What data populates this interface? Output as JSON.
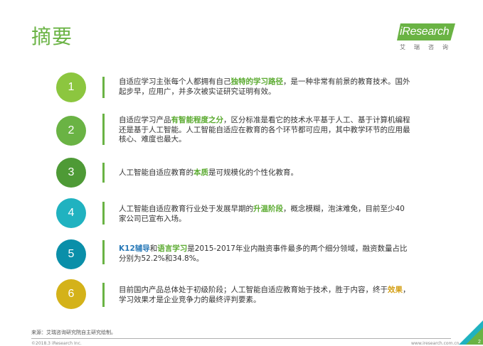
{
  "page": {
    "title": "摘要"
  },
  "logo": {
    "text": "iResearch",
    "sub": "艾瑞咨询"
  },
  "colors": {
    "accent": "#6ab344",
    "circle_1": "#8cc63f",
    "circle_2": "#6ab344",
    "circle_3": "#4e9a36",
    "circle_4": "#20b2c0",
    "circle_5": "#0a8fa9",
    "circle_6": "#d4b219"
  },
  "items": [
    {
      "num": "1",
      "parts": [
        "自适应学习主张每个人都拥有自己",
        "独特的学习路径",
        "，是一种非常有前景的教育技术。国外起步早，应用广，并多次被实证研究证明有效。"
      ]
    },
    {
      "num": "2",
      "parts": [
        "自适应学习产品",
        "有智能程度之分",
        "，区分标准是看它的技术水平基于人工、基于计算机编程还是基于人工智能。人工智能自适应在教育的各个环节都可应用，其中教学环节的应用最核心、难度也最大。"
      ]
    },
    {
      "num": "3",
      "parts": [
        "人工智能自适应教育的",
        "本质",
        "是可规模化的个性化教育。"
      ]
    },
    {
      "num": "4",
      "parts": [
        "人工智能自适应教育行业处于发展早期的",
        "升温阶段",
        "，概念模糊，泡沫难免，目前至少40家公司已宣布入场。"
      ]
    },
    {
      "num": "5",
      "parts": [
        "K12辅导",
        "和",
        "语言学习",
        "是2015-2017年业内融资事件最多的两个细分领域，融资数量占比分别为52.2%和34.8%。"
      ]
    },
    {
      "num": "6",
      "parts": [
        "目前国内产品总体处于初级阶段；人工智能自适应教育始于技术，胜于内容，终于",
        "效果",
        "，学习效果才是企业竞争力的最终评判要素。"
      ]
    }
  ],
  "footer": {
    "source": "来源：艾瑞咨询研究院自主研究绘制。",
    "copyright": "©2018.3 iResearch Inc.",
    "site": "www.iresearch.com.cn",
    "page_number": "2"
  }
}
